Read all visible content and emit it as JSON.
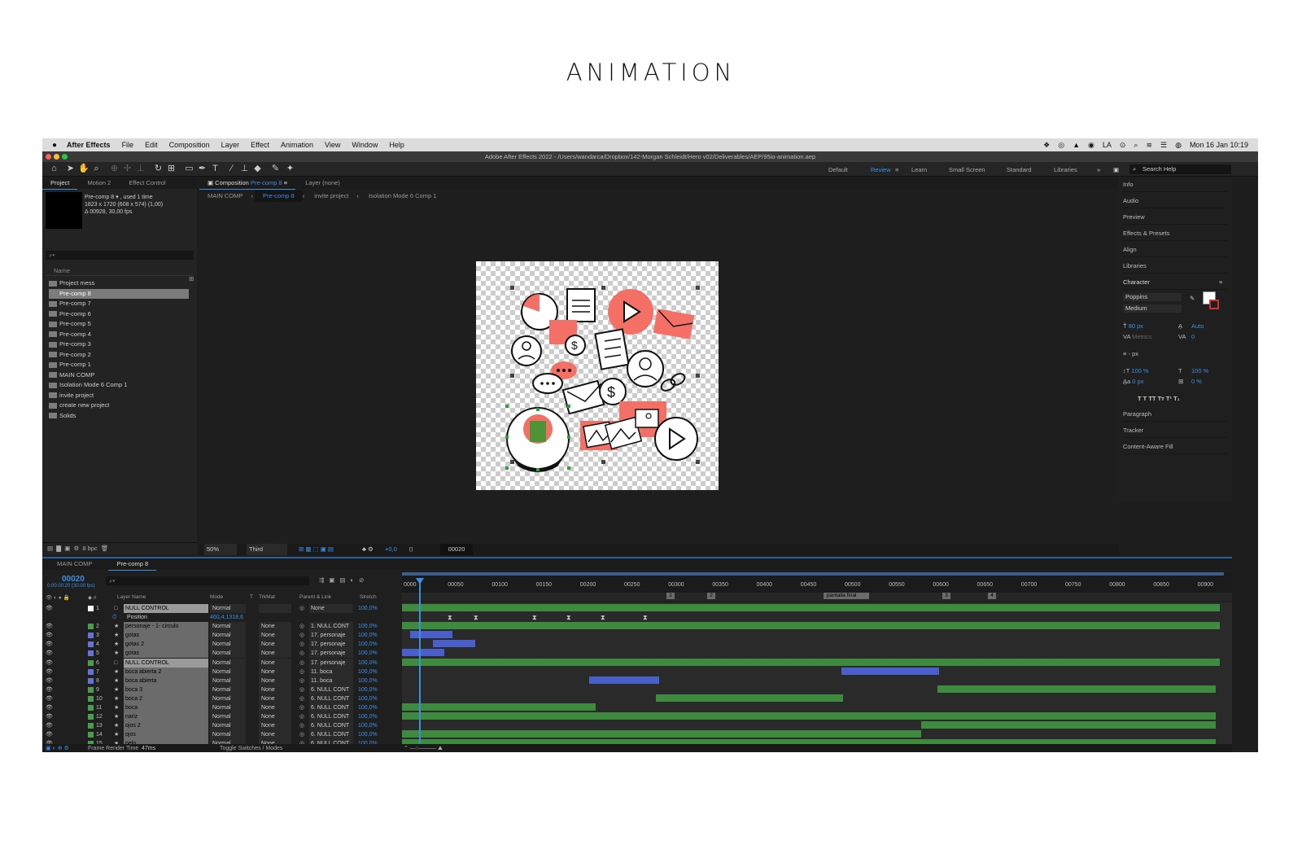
{
  "heading": "ANIMATION",
  "menubar": {
    "app_name": "After Effects",
    "items": [
      "File",
      "Edit",
      "Composition",
      "Layer",
      "Effect",
      "Animation",
      "View",
      "Window",
      "Help"
    ],
    "clock": "Mon 16 Jan  10:19"
  },
  "window_title": "Adobe After Effects 2022 - /Users/wandarca/Dropbox/142-Morgan Schleidt/Hero v02/Deliverables/AEP/95io-animation.aep",
  "workspaces": [
    "Default",
    "Review",
    "Learn",
    "Small Screen",
    "Standard",
    "Libraries"
  ],
  "active_workspace": "Review",
  "search_help": "Search Help",
  "project_panel": {
    "tabs": [
      "Project",
      "Motion 2",
      "Effect Control"
    ],
    "item_title": "Pre-comp 8 ▾ , used 1 time",
    "item_size": "1823 x 1720  (608 x 574) (1,00)",
    "item_duration": "Δ 00928, 30,00 fps",
    "column_name": "Name",
    "items": [
      "Project mess",
      "Pre-comp 8",
      "Pre-comp 7",
      "Pre-comp 6",
      "Pre-comp 5",
      "Pre-comp 4",
      "Pre-comp 3",
      "Pre-comp 2",
      "Pre-comp 1",
      "MAIN COMP",
      "Isolation Mode 6 Comp 1",
      "invite project",
      "create new project",
      "Solids"
    ],
    "selected": "Pre-comp 8",
    "bpc": "8 bpc"
  },
  "comp_panel": {
    "tab_label": "Composition",
    "tab_comp": "Pre-comp 8",
    "layer_tab": "Layer (none)",
    "breadcrumbs": [
      "MAIN COMP",
      "Pre-comp 8",
      "invite project",
      "Isolation Mode 6 Comp 1"
    ],
    "zoom": "50%",
    "resolution": "Third",
    "exposure": "+0,0",
    "timecode": "00020"
  },
  "right_panel": {
    "items": [
      "Info",
      "Audio",
      "Preview",
      "Effects & Presets",
      "Align",
      "Libraries"
    ],
    "character": {
      "title": "Character",
      "font": "Poppins",
      "weight": "Medium",
      "size": "80 px",
      "leading": "Auto",
      "kerning": "Metrics",
      "tracking": "0",
      "stroke": "- px",
      "vscale": "100 %",
      "hscale": "100 %",
      "baseline": "0 px",
      "tsume": "0 %",
      "styles": "T  T  TT  Tт  T¹  T₁"
    },
    "bottom_items": [
      "Paragraph",
      "Tracker",
      "Content-Aware Fill"
    ]
  },
  "timeline": {
    "tabs": [
      "MAIN COMP",
      "Pre-comp 8"
    ],
    "timecode": "00020",
    "fps": "0:00:00:20 (30.00 fps)",
    "headers": {
      "name": "Layer Name",
      "mode": "Mode",
      "t": "T",
      "trkmat": "TrkMat",
      "parent": "Parent & Link",
      "stretch": "Stretch"
    },
    "position_label": "Position",
    "position_value": "460,4,1318,6",
    "layers": [
      {
        "num": "1",
        "name": "NULL CONTROL",
        "mode": "Normal",
        "trk": "",
        "parent": "None",
        "stretch": "100,0%",
        "color": "#ffffff",
        "null": true
      },
      {
        "num": "2",
        "name": "personaje - 1- circulo",
        "mode": "Normal",
        "trk": "None",
        "parent": "1. NULL CONT",
        "stretch": "100,0%",
        "color": "#4a9e4a"
      },
      {
        "num": "3",
        "name": "gotas",
        "mode": "Normal",
        "trk": "None",
        "parent": "17. personaje",
        "stretch": "100,0%",
        "color": "#6672d9"
      },
      {
        "num": "4",
        "name": "gotas 2",
        "mode": "Normal",
        "trk": "None",
        "parent": "17. personaje",
        "stretch": "100,0%",
        "color": "#6672d9"
      },
      {
        "num": "5",
        "name": "gotas",
        "mode": "Normal",
        "trk": "None",
        "parent": "17. personaje",
        "stretch": "100,0%",
        "color": "#6672d9"
      },
      {
        "num": "6",
        "name": "NULL CONTROL",
        "mode": "Normal",
        "trk": "None",
        "parent": "17. personaje",
        "stretch": "100,0%",
        "color": "#4a9e4a",
        "null": true
      },
      {
        "num": "7",
        "name": "boca abierta 2",
        "mode": "Normal",
        "trk": "None",
        "parent": "11. boca",
        "stretch": "100,0%",
        "color": "#6672d9"
      },
      {
        "num": "8",
        "name": "boca abierta",
        "mode": "Normal",
        "trk": "None",
        "parent": "11. boca",
        "stretch": "100,0%",
        "color": "#6672d9"
      },
      {
        "num": "9",
        "name": "boca 3",
        "mode": "Normal",
        "trk": "None",
        "parent": "6. NULL CONT",
        "stretch": "100,0%",
        "color": "#4a9e4a"
      },
      {
        "num": "10",
        "name": "boca 2",
        "mode": "Normal",
        "trk": "None",
        "parent": "6. NULL CONT",
        "stretch": "100,0%",
        "color": "#4a9e4a"
      },
      {
        "num": "11",
        "name": "boca",
        "mode": "Normal",
        "trk": "None",
        "parent": "6. NULL CONT",
        "stretch": "100,0%",
        "color": "#4a9e4a"
      },
      {
        "num": "12",
        "name": "nariz",
        "mode": "Normal",
        "trk": "None",
        "parent": "6. NULL CONT",
        "stretch": "100,0%",
        "color": "#4a9e4a"
      },
      {
        "num": "13",
        "name": "ojos 2",
        "mode": "Normal",
        "trk": "None",
        "parent": "6. NULL CONT",
        "stretch": "100,0%",
        "color": "#4a9e4a"
      },
      {
        "num": "14",
        "name": "ojos",
        "mode": "Normal",
        "trk": "None",
        "parent": "6. NULL CONT",
        "stretch": "100,0%",
        "color": "#4a9e4a"
      },
      {
        "num": "15",
        "name": "pelo",
        "mode": "Normal",
        "trk": "None",
        "parent": "6. NULL CONT",
        "stretch": "100,0%",
        "color": "#4a9e4a"
      }
    ],
    "ruler_labels": [
      "0000",
      "00050",
      "00100",
      "00150",
      "00200",
      "00250",
      "00300",
      "00350",
      "00400",
      "00450",
      "00500",
      "00550",
      "00600",
      "00650",
      "00700",
      "00750",
      "00800",
      "00850",
      "00900"
    ],
    "marker_label": "pantalla final",
    "markers": [
      "1",
      "2",
      "3",
      "4"
    ],
    "render_time_label": "Frame Render Time",
    "render_time": "47ms",
    "toggle_label": "Toggle Switches / Modes"
  }
}
